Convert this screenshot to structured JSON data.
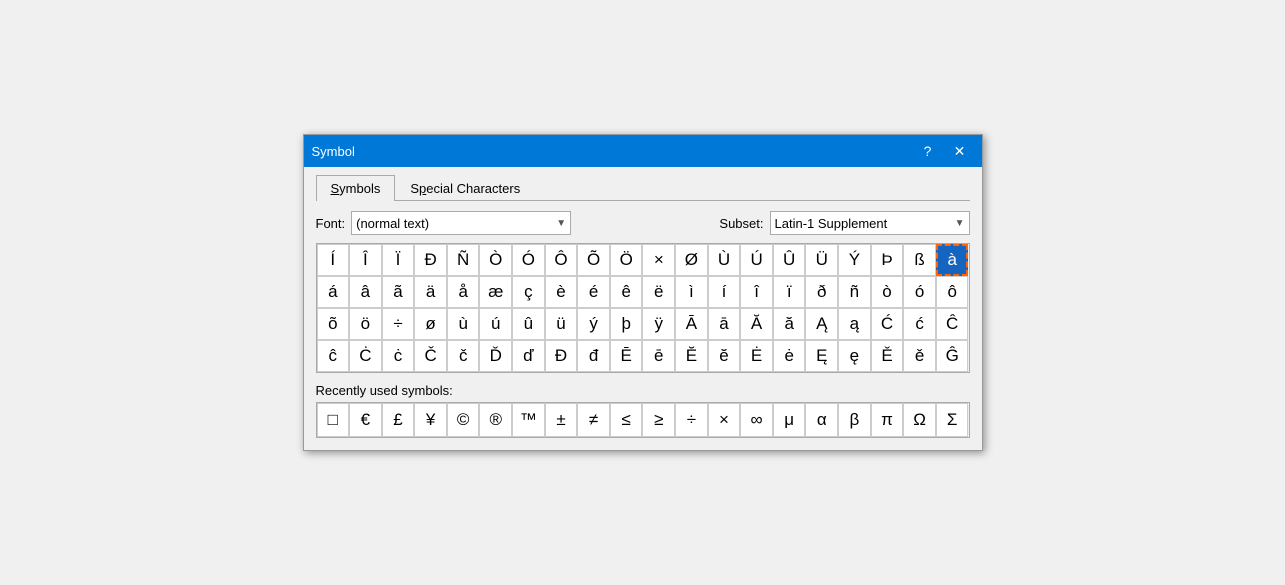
{
  "window": {
    "title": "Symbol",
    "help_label": "?",
    "close_label": "✕"
  },
  "tabs": [
    {
      "id": "symbols",
      "label": "Symbols",
      "underline_char": "S",
      "active": true
    },
    {
      "id": "special",
      "label": "Special Characters",
      "underline_char": "p",
      "active": false
    }
  ],
  "font_label": "Font:",
  "font_value": "(normal text)",
  "subset_label": "Subset:",
  "subset_value": "Latin-1 Supplement",
  "symbol_rows": [
    [
      "Í",
      "Î",
      "Ï",
      "Ð",
      "Ñ",
      "Ò",
      "Ó",
      "Ô",
      "Õ",
      "Ö",
      "×",
      "Ø",
      "Ù",
      "Ú",
      "Û",
      "Ü",
      "Ý",
      "Þ",
      "ß",
      "à"
    ],
    [
      "á",
      "â",
      "ã",
      "ä",
      "å",
      "æ",
      "ç",
      "è",
      "é",
      "ê",
      "ë",
      "ì",
      "í",
      "î",
      "ï",
      "ð",
      "ñ",
      "ò",
      "ó",
      "ô"
    ],
    [
      "õ",
      "ö",
      "÷",
      "ø",
      "ù",
      "ú",
      "û",
      "ü",
      "ý",
      "þ",
      "ÿ",
      "Ā",
      "ā",
      "Ă",
      "ă",
      "Ą",
      "ą",
      "Ć",
      "ć",
      "Ĉ"
    ],
    [
      "ĉ",
      "Ċ",
      "ċ",
      "Č",
      "č",
      "Ď",
      "ď",
      "Đ",
      "đ",
      "Ē",
      "ē",
      "Ĕ",
      "ĕ",
      "Ė",
      "ė",
      "Ę",
      "ę",
      "Ě",
      "ě",
      "Ĝ"
    ]
  ],
  "selected_cell": {
    "row": 0,
    "col": 19
  },
  "recently_used_label": "Recently used symbols:",
  "recently_symbols": [
    "□",
    "€",
    "£",
    "¥",
    "©",
    "®",
    "™",
    "±",
    "≠",
    "≤",
    "≥",
    "÷",
    "×",
    "∞",
    "μ",
    "α",
    "β",
    "π",
    "Ω",
    "Σ"
  ]
}
